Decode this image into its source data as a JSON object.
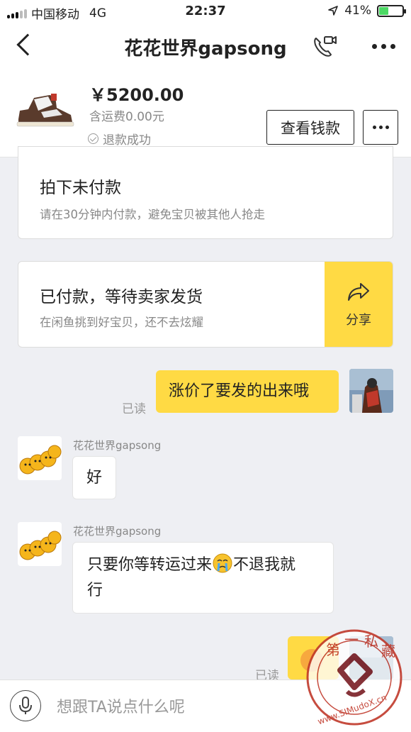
{
  "status": {
    "carrier": "中国移动",
    "network": "4G",
    "time": "22:37",
    "battery": "41%"
  },
  "nav": {
    "title": "花花世界gapsong"
  },
  "item": {
    "price": "￥5200.00",
    "shipping": "含运费0.00元",
    "status": "退款成功",
    "check_label": "查看钱款"
  },
  "cards": [
    {
      "title": "拍下未付款",
      "subtitle": "请在30分钟内付款，避免宝贝被其他人抢走"
    },
    {
      "title": "已付款，等待卖家发货",
      "subtitle": "在闲鱼挑到好宝贝，还不去炫耀",
      "action": "分享"
    }
  ],
  "messages": [
    {
      "from": "me",
      "text": "涨价了要发的出来哦",
      "read": "已读"
    },
    {
      "from": "other",
      "sender": "花花世界gapsong",
      "text": "好"
    },
    {
      "from": "other",
      "sender": "花花世界gapsong",
      "line1": "只要你等转运过来",
      "line1b": "不退我就",
      "line2": "行"
    },
    {
      "from": "me",
      "read": "已读"
    }
  ],
  "input": {
    "placeholder": "想跟TA说点什么呢"
  },
  "watermark": {
    "chars": [
      "第",
      "一",
      "私",
      "藏"
    ],
    "url": "www.SIMudoX.cn"
  },
  "colors": {
    "accent": "#ffda44",
    "background": "#eeeff3"
  },
  "icons": [
    "back-icon",
    "video-call-icon",
    "more-icon",
    "check-circle-icon",
    "share-arrow-icon",
    "microphone-icon",
    "crying-emoji-icon"
  ]
}
